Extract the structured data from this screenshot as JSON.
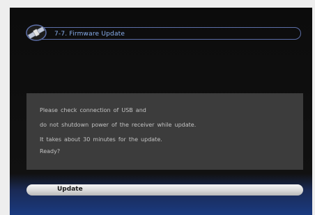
{
  "header": {
    "title": "7-7. Firmware Update",
    "icon": "satellite-icon"
  },
  "message": {
    "lines": [
      "Please check connection of USB and",
      "do not shutdown power of the receiver while update.",
      "It takes about 30 minutes for the update.",
      "Ready?"
    ]
  },
  "actions": {
    "update_label": "Update"
  },
  "colors": {
    "title_text": "#8ab0f0",
    "title_border": "#5d6fa8",
    "message_bg": "#3c3c3c",
    "message_text": "#c4c4c4",
    "button_bg": "#d9d9d9"
  }
}
